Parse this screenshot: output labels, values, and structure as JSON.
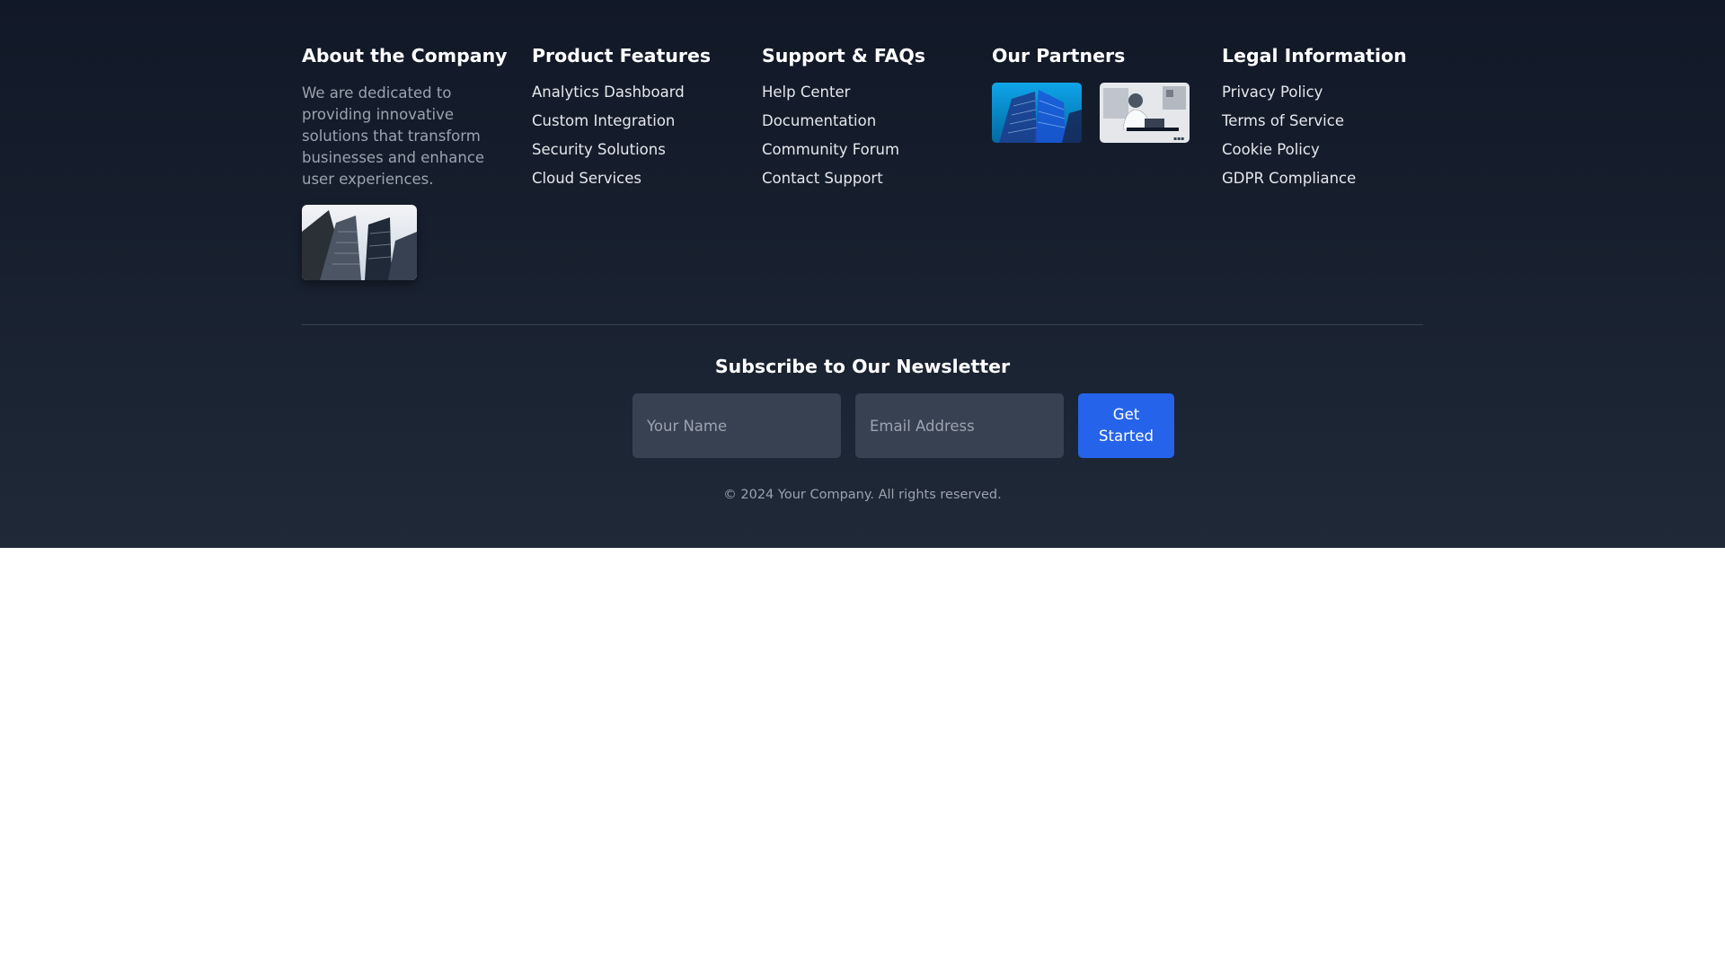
{
  "about": {
    "title": "About the Company",
    "text": "We are dedicated to providing innovative solutions that transform businesses and enhance user experiences."
  },
  "features": {
    "title": "Product Features",
    "items": [
      "Analytics Dashboard",
      "Custom Integration",
      "Security Solutions",
      "Cloud Services"
    ]
  },
  "support": {
    "title": "Support & FAQs",
    "items": [
      "Help Center",
      "Documentation",
      "Community Forum",
      "Contact Support"
    ]
  },
  "partners": {
    "title": "Our Partners"
  },
  "legal": {
    "title": "Legal Information",
    "items": [
      "Privacy Policy",
      "Terms of Service",
      "Cookie Policy",
      "GDPR Compliance"
    ]
  },
  "newsletter": {
    "title": "Subscribe to Our Newsletter",
    "name_placeholder": "Your Name",
    "email_placeholder": "Email Address",
    "button_label": "Get Started"
  },
  "copyright": "© 2024 Your Company. All rights reserved.",
  "colors": {
    "background_top": "#111827",
    "background_bottom": "#1f2937",
    "accent": "#2563eb",
    "input_bg": "#374151"
  }
}
